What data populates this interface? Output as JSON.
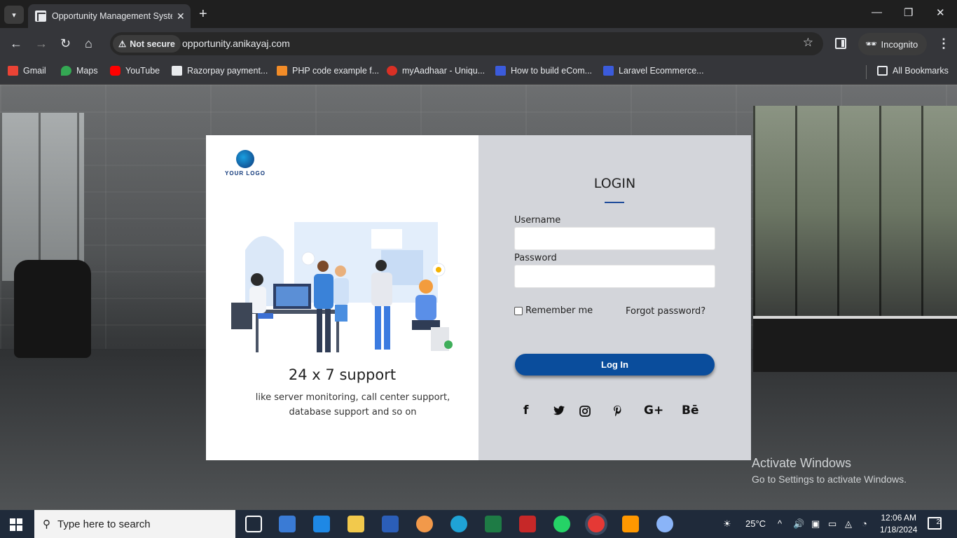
{
  "browser": {
    "tab_title": "Opportunity Management System",
    "security_chip": "Not secure",
    "url": "opportunity.anikayaj.com",
    "incognito_label": "Incognito",
    "bookmarks": [
      {
        "label": "Gmail",
        "icon": "gmail-icon",
        "color": "#ea4335"
      },
      {
        "label": "Maps",
        "icon": "maps-icon",
        "color": "#34a853"
      },
      {
        "label": "YouTube",
        "icon": "youtube-icon",
        "color": "#ff0000"
      },
      {
        "label": "Razorpay payment...",
        "icon": "razorpay-icon",
        "color": "#e8eaed"
      },
      {
        "label": "PHP code example f...",
        "icon": "php-icon",
        "color": "#f28c28"
      },
      {
        "label": "myAadhaar - Uniqu...",
        "icon": "aadhaar-icon",
        "color": "#d93025"
      },
      {
        "label": "How to build eCom...",
        "icon": "webkul-icon",
        "color": "#3b5bdb"
      },
      {
        "label": "Laravel Ecommerce...",
        "icon": "webkul-icon",
        "color": "#3b5bdb"
      }
    ],
    "all_bookmarks": "All Bookmarks"
  },
  "login_card": {
    "logo_text": "YOUR LOGO",
    "support_title": "24 x 7 support",
    "support_text": "like server monitoring, call center support, database support and so on",
    "login_title": "LOGIN",
    "username_label": "Username",
    "username_value": "",
    "password_label": "Password",
    "password_value": "",
    "remember_label": "Remember me",
    "remember_checked": false,
    "forgot_label": "Forgot password?",
    "submit_label": "Log In",
    "social": [
      "f",
      "twitter-icon",
      "instagram-icon",
      "pinterest-icon",
      "G+",
      "Bē"
    ]
  },
  "watermark": {
    "line1": "Activate Windows",
    "line2": "Go to Settings to activate Windows."
  },
  "taskbar": {
    "search_placeholder": "Type here to search",
    "temperature": "25°C",
    "time": "12:06 AM",
    "date": "1/18/2024",
    "notifications": "2"
  },
  "colors": {
    "login_button": "#0a4d9c",
    "right_panel": "#d3d5da",
    "accent_line": "#1e4c9a"
  }
}
